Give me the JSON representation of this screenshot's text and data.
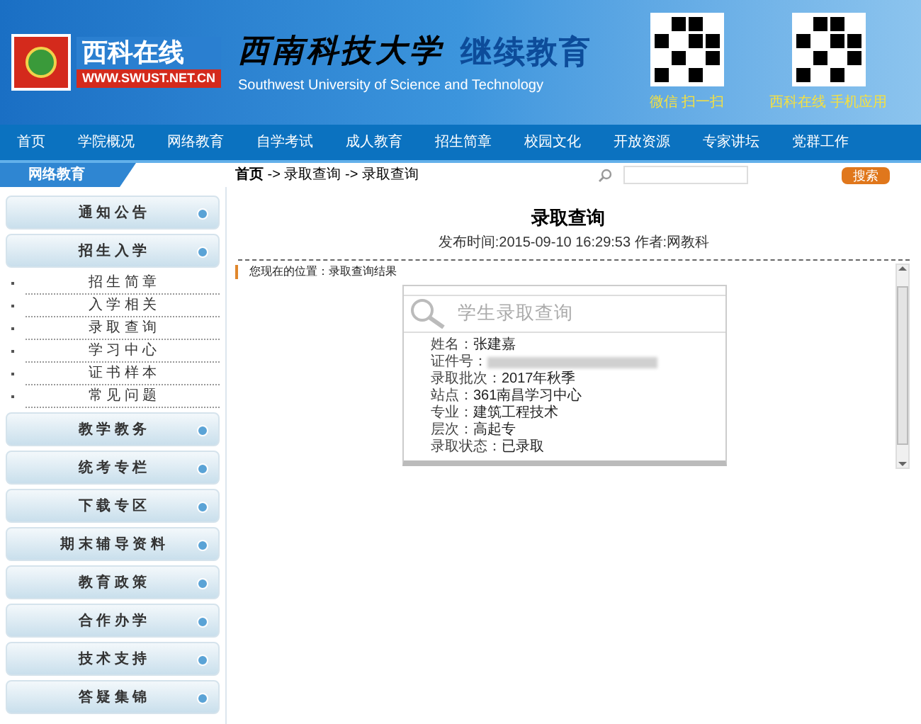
{
  "header": {
    "logo_text": "西科在线",
    "logo_url": "WWW.SWUST.NET.CN",
    "school_name": "西南科技大学",
    "program_name": "继续教育",
    "english_name": "Southwest University of Science and Technology",
    "qr_codes": [
      {
        "caption": "微信 扫一扫"
      },
      {
        "caption": "西科在线 手机应用"
      }
    ]
  },
  "nav": {
    "items": [
      {
        "label": "首页"
      },
      {
        "label": "学院概况"
      },
      {
        "label": "网络教育"
      },
      {
        "label": "自学考试"
      },
      {
        "label": "成人教育"
      },
      {
        "label": "招生简章"
      },
      {
        "label": "校园文化"
      },
      {
        "label": "开放资源"
      },
      {
        "label": "专家讲坛"
      },
      {
        "label": "党群工作"
      }
    ]
  },
  "sidebar": {
    "title": "网络教育",
    "sections": [
      {
        "label": "通 知 公 告"
      },
      {
        "label": "招 生 入 学",
        "children": [
          {
            "label": "招 生 简 章"
          },
          {
            "label": "入 学 相 关"
          },
          {
            "label": "录 取 查 询"
          },
          {
            "label": "学 习 中 心"
          },
          {
            "label": "证 书 样 本"
          },
          {
            "label": "常 见 问 题"
          }
        ]
      },
      {
        "label": "教 学 教 务"
      },
      {
        "label": "统 考 专 栏"
      },
      {
        "label": "下 载 专 区"
      },
      {
        "label": "期 末 辅 导 资 料"
      },
      {
        "label": "教 育 政 策"
      },
      {
        "label": "合 作 办 学"
      },
      {
        "label": "技 术 支 持"
      },
      {
        "label": "答 疑 集 锦"
      }
    ]
  },
  "breadcrumb": "**首页** -> 录取查询 -> 录取查询",
  "search": {
    "button": "搜索"
  },
  "article": {
    "title": "录取查询",
    "meta": "发布时间:2015-09-10 16:29:53 作者:网教科",
    "location": "您现在的位置：录取查询结果",
    "card": {
      "title": "学生录取查询",
      "fields": [
        {
          "kind": "plain",
          "label": "姓名：",
          "value": "张建嘉"
        },
        {
          "kind": "redacted",
          "label": "证件号："
        },
        {
          "kind": "plain",
          "label": "录取批次：",
          "value": "2017年秋季"
        },
        {
          "kind": "plain",
          "label": "站点：",
          "value": "361南昌学习中心"
        },
        {
          "kind": "plain",
          "label": "专业：",
          "value": "建筑工程技术"
        },
        {
          "kind": "plain",
          "label": "层次：",
          "value": "高起专"
        },
        {
          "kind": "plain",
          "label": "录取状态：",
          "value": "已录取"
        }
      ]
    }
  }
}
